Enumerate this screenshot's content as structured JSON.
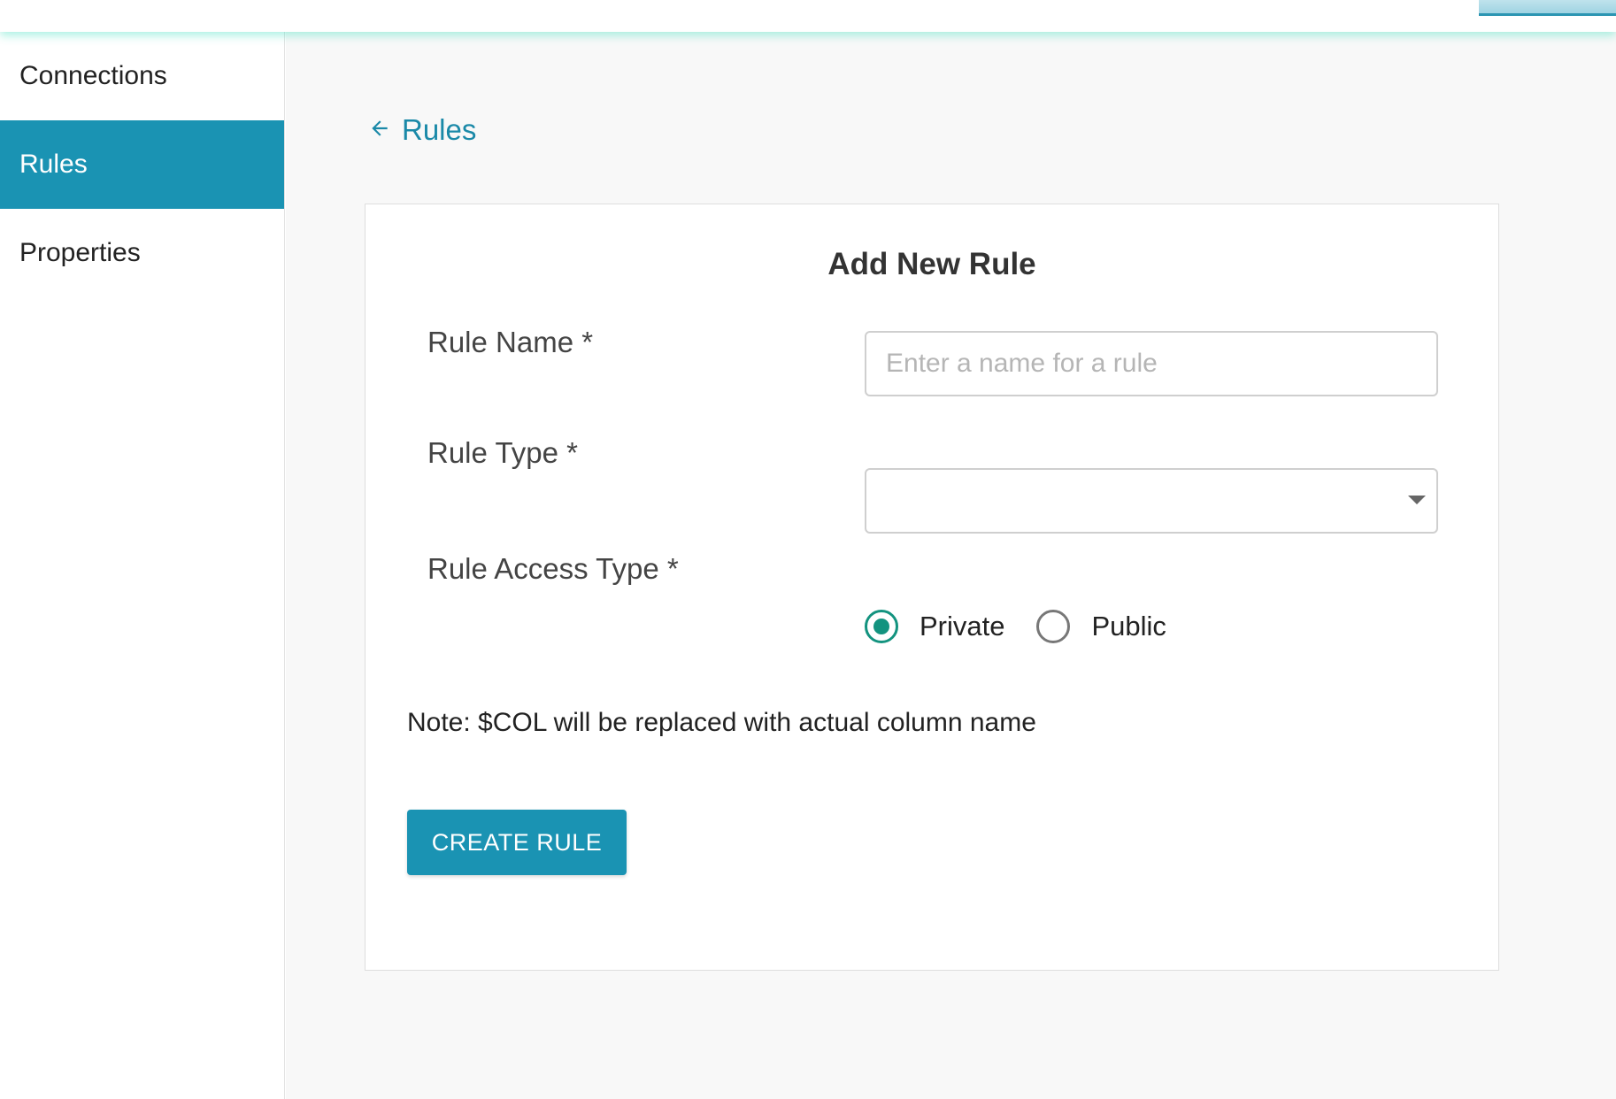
{
  "sidebar": {
    "items": [
      {
        "label": "Connections",
        "active": false
      },
      {
        "label": "Rules",
        "active": true
      },
      {
        "label": "Properties",
        "active": false
      }
    ]
  },
  "main": {
    "back_link": {
      "icon": "arrow-left-icon",
      "label": "Rules"
    },
    "form": {
      "title": "Add New Rule",
      "rule_name": {
        "label": "Rule Name *",
        "value": "",
        "placeholder": "Enter a name for a rule"
      },
      "rule_type": {
        "label": "Rule Type *",
        "selected": ""
      },
      "access_type": {
        "label": "Rule Access Type *",
        "options": [
          {
            "label": "Private",
            "checked": true
          },
          {
            "label": "Public",
            "checked": false
          }
        ]
      },
      "note": "Note: $COL will be replaced with actual column name",
      "submit_label": "CREATE RULE"
    }
  },
  "colors": {
    "accent": "#1a93b3",
    "radio_checked": "#13937f",
    "link": "#1a89a8"
  }
}
